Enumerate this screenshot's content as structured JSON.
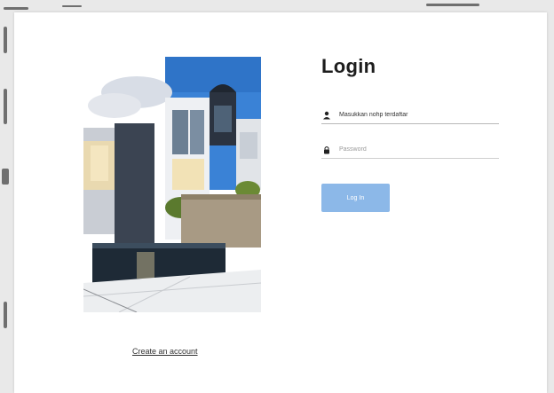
{
  "login": {
    "title": "Login",
    "username_placeholder": "Masukkan nohp terdaftar",
    "username_value": "",
    "password_placeholder": "Password",
    "password_value": "",
    "submit_label": "Log In",
    "create_account_label": "Create an account"
  },
  "icons": {
    "username": "user-icon",
    "password": "lock-icon"
  },
  "colors": {
    "button": "#8cb8e8",
    "title": "#1d1d1d",
    "sky": "#3a82d6"
  }
}
